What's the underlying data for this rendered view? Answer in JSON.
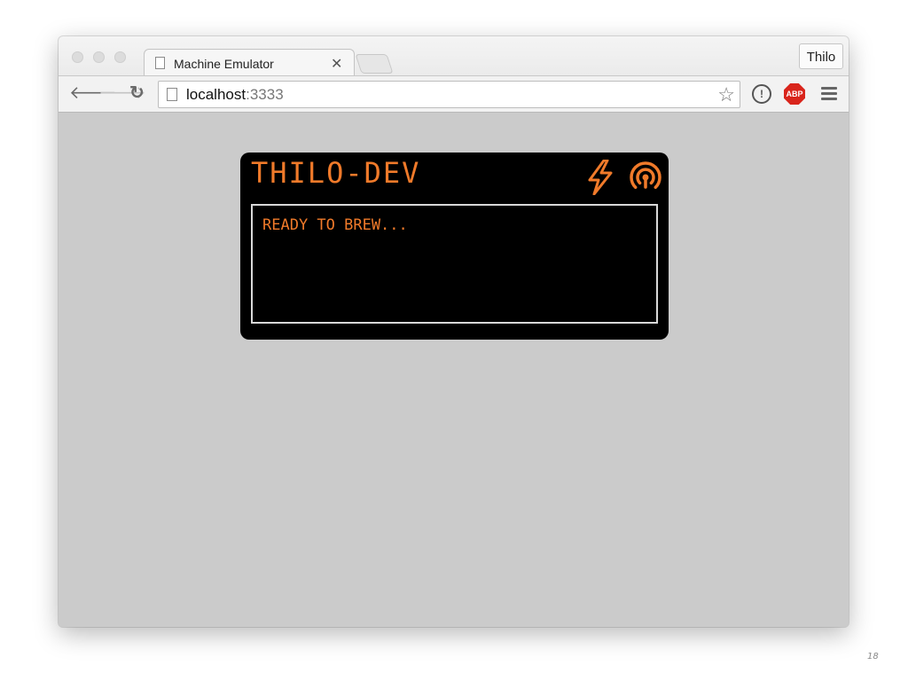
{
  "browser": {
    "tab": {
      "title": "Machine Emulator",
      "close_glyph": "✕"
    },
    "profile_label": "Thilo",
    "nav": {
      "back_glyph": "🡐",
      "forward_glyph": "🡒",
      "reload_glyph": "↻"
    },
    "address": {
      "host": "localhost",
      "port": ":3333"
    },
    "bookmark_glyph": "☆",
    "extensions": {
      "first_glyph": "!",
      "adblock_label": "ABP"
    }
  },
  "machine": {
    "name": "THILO-DEV",
    "status_text": "READY TO BREW...",
    "accent_color": "#f07a2a",
    "icons": [
      "bolt-icon",
      "signal-icon"
    ]
  },
  "slide": {
    "page_number": "18"
  }
}
